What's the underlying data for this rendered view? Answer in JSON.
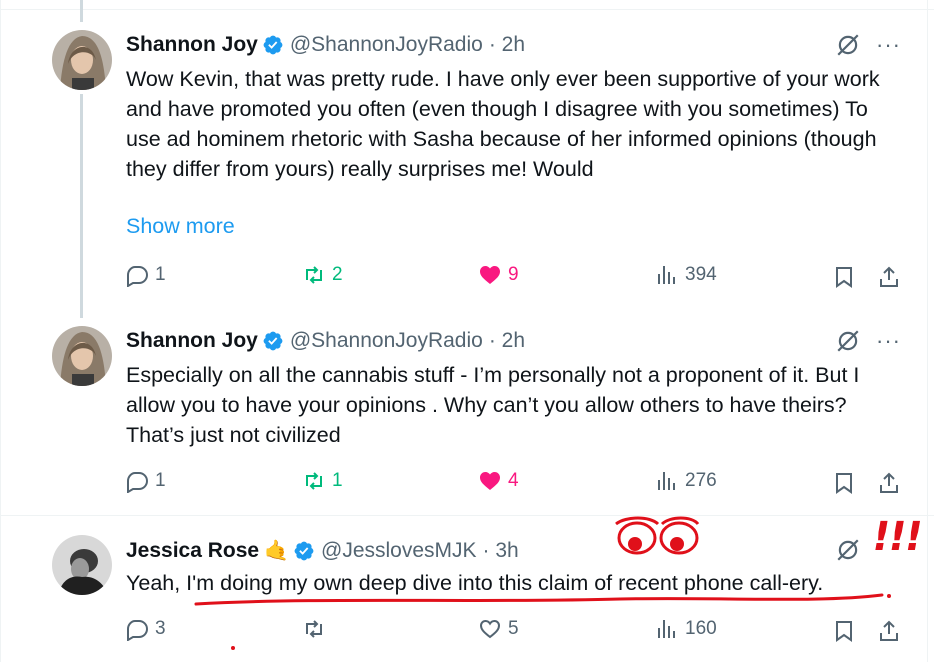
{
  "tweets": [
    {
      "name": "Shannon Joy",
      "handle": "@ShannonJoyRadio",
      "time": "· 2h",
      "text": "Wow Kevin, that was pretty rude. I have only ever been supportive of your work and have promoted you often (even though I disagree with you sometimes) To use ad hominem rhetoric with Sasha because of her informed opinions (though they differ from yours) really surprises me! Would",
      "show_more": "Show more",
      "replies": "1",
      "reposts": "2",
      "likes": "9",
      "views": "394"
    },
    {
      "name": "Shannon Joy",
      "handle": "@ShannonJoyRadio",
      "time": "· 2h",
      "text": "Especially on all the cannabis stuff - I’m personally not a proponent of it. But I allow you to have your opinions . Why can’t you allow others to have theirs? That’s just not civilized",
      "replies": "1",
      "reposts": "1",
      "likes": "4",
      "views": "276"
    },
    {
      "name": "Jessica Rose",
      "emoji": "🤙",
      "handle": "@JesslovesMJK",
      "time": "· 3h",
      "text": "Yeah, I'm doing my own deep dive into this claim of recent phone call-ery.",
      "replies": "3",
      "reposts": "",
      "likes": "5",
      "views": "160"
    }
  ],
  "annotation": {
    "exclamations": "!!!",
    "color": "#e0101a"
  },
  "colors": {
    "verified": "#1d9bf0",
    "repost_active": "#00ba7c",
    "like_active": "#f91880",
    "muted": "#536471",
    "link": "#1d9bf0"
  },
  "more_glyph": "···"
}
